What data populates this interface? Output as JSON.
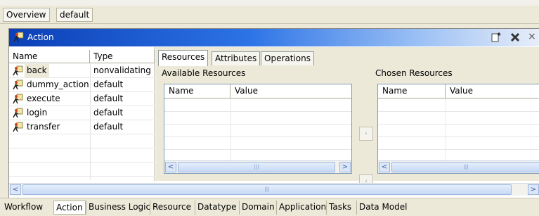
{
  "top_tabs": [
    "Overview",
    "default"
  ],
  "panel": {
    "title": "Action",
    "title_icon": "action-running-figure-icon",
    "buttons": [
      {
        "name": "new-document-icon"
      },
      {
        "name": "delete-icon"
      },
      {
        "name": "close-icon",
        "glyph": "×"
      }
    ]
  },
  "list": {
    "headers": [
      "Name",
      "Type"
    ],
    "rows": [
      {
        "name": "back",
        "type": "nonvalidating",
        "icon": "action-icon"
      },
      {
        "name": "dummy_action",
        "type": "default",
        "icon": "action-icon"
      },
      {
        "name": "execute",
        "type": "default",
        "icon": "action-icon"
      },
      {
        "name": "login",
        "type": "default",
        "icon": "action-icon"
      },
      {
        "name": "transfer",
        "type": "default",
        "icon": "action-icon"
      }
    ]
  },
  "detail_tabs": [
    "Resources",
    "Attributes",
    "Operations"
  ],
  "available": {
    "label": "Available Resources",
    "headers": [
      "Name",
      "Value"
    ]
  },
  "chosen": {
    "label": "Chosen Resources",
    "headers": [
      "Name",
      "Value"
    ]
  },
  "move_buttons": [
    {
      "name": "move-right-icon",
      "glyph": "›"
    },
    {
      "name": "move-left-icon",
      "glyph": "‹"
    }
  ],
  "scroll_glyphs": {
    "left": "<",
    "right": ">",
    "grip": "|||"
  },
  "bottom_tabs": [
    "Workflow",
    "Action",
    "Business Logic",
    "Resource",
    "Datatype",
    "Domain",
    "Application",
    "Tasks",
    "Data Model"
  ],
  "colors": {
    "title_start": "#0b3fb6",
    "title_end": "#e8eef8",
    "panel_bg": "#ece9d8"
  }
}
